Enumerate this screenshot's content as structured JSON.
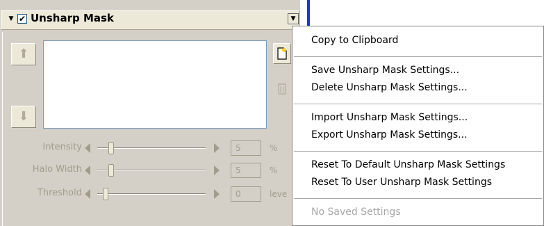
{
  "panel": {
    "title": "Unsharp Mask",
    "enabled_check": "✔",
    "collapse_glyph": "▼",
    "menu_button_glyph": "▼",
    "up_arrow": "⬆",
    "down_arrow": "⬇",
    "new_settings_icon": "new-document-icon",
    "delete_settings_icon": "trash-icon"
  },
  "sliders": [
    {
      "label": "Intensity",
      "value": "5",
      "unit": "%",
      "position": 0.06
    },
    {
      "label": "Halo Width",
      "value": "5",
      "unit": "%",
      "position": 0.06
    },
    {
      "label": "Threshold",
      "value": "0",
      "unit": "leve",
      "position": 0.0
    }
  ],
  "context_menu": {
    "copy": "Copy to Clipboard",
    "save": "Save Unsharp Mask Settings...",
    "delete": "Delete Unsharp Mask Settings...",
    "import": "Import Unsharp Mask Settings...",
    "export": "Export Unsharp Mask Settings...",
    "reset_default": "Reset To Default Unsharp Mask Settings",
    "reset_user": "Reset To User Unsharp Mask Settings",
    "no_saved": "No Saved Settings"
  }
}
